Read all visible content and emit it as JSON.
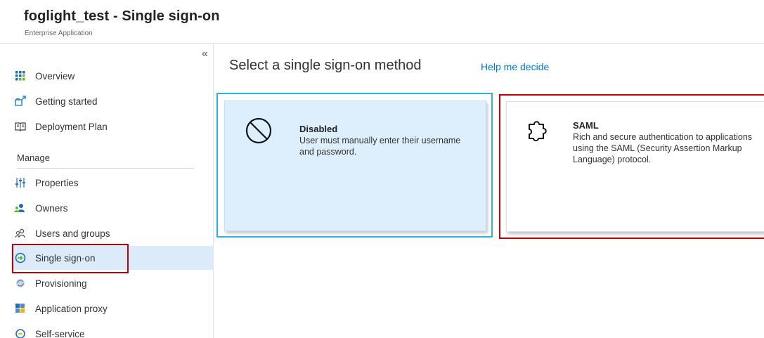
{
  "header": {
    "title": "foglight_test - Single sign-on",
    "subtitle": "Enterprise Application"
  },
  "sidebar": {
    "collapse_glyph": "«",
    "items_top": [
      {
        "label": "Overview",
        "icon": "overview-icon"
      },
      {
        "label": "Getting started",
        "icon": "getting-started-icon"
      },
      {
        "label": "Deployment Plan",
        "icon": "book-icon"
      }
    ],
    "section_label": "Manage",
    "items_manage": [
      {
        "label": "Properties",
        "icon": "properties-icon"
      },
      {
        "label": "Owners",
        "icon": "owners-icon"
      },
      {
        "label": "Users and groups",
        "icon": "users-icon"
      },
      {
        "label": "Single sign-on",
        "icon": "sso-icon",
        "selected": true
      },
      {
        "label": "Provisioning",
        "icon": "provisioning-icon"
      },
      {
        "label": "Application proxy",
        "icon": "app-proxy-icon"
      },
      {
        "label": "Self-service",
        "icon": "self-service-icon"
      }
    ]
  },
  "main": {
    "title": "Select a single sign-on method",
    "help_link": "Help me decide",
    "cards": [
      {
        "name": "Disabled",
        "description": "User must manually enter their username and password.",
        "icon": "disabled-icon",
        "state": "selected"
      },
      {
        "name": "SAML",
        "description": "Rich and secure authentication to applications using the SAML (Security Assertion Markup Language) protocol.",
        "icon": "puzzle-icon",
        "state": "highlighted"
      }
    ]
  },
  "colors": {
    "accent_link": "#0078d4",
    "selected_bg": "#dcebf9",
    "selection_border": "#2bb3e8",
    "highlight_border": "#c00000"
  }
}
